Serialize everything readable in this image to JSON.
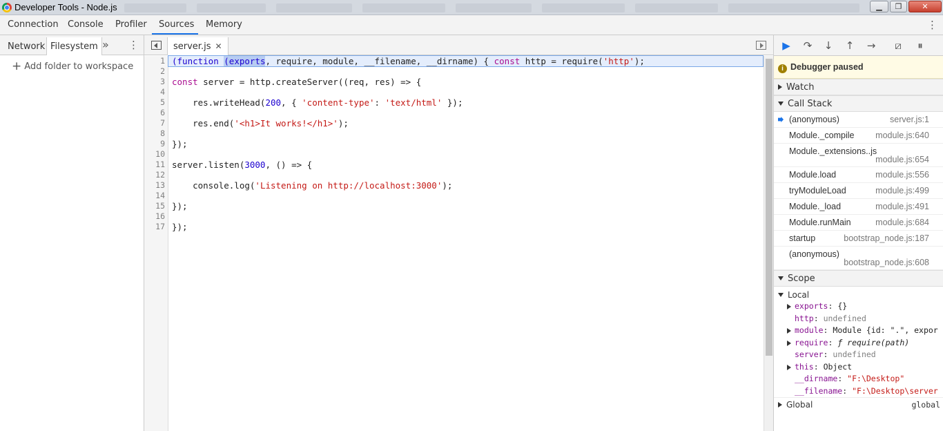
{
  "window": {
    "title": "Developer Tools - Node.js",
    "minimize": "▁",
    "maximize": "❐",
    "close": "✕"
  },
  "main_tabs": [
    "Connection",
    "Console",
    "Profiler",
    "Sources",
    "Memory"
  ],
  "navigator": {
    "tabs": [
      "Network",
      "Filesystem"
    ],
    "more": "»",
    "add_folder": "Add folder to workspace"
  },
  "editor": {
    "file_tab": "server.js",
    "line_numbers": [
      "1",
      "2",
      "3",
      "4",
      "5",
      "6",
      "7",
      "8",
      "9",
      "10",
      "11",
      "12",
      "13",
      "14",
      "15",
      "16",
      "17"
    ]
  },
  "debugger": {
    "paused_text": "Debugger paused",
    "watch": "Watch",
    "call_stack": "Call Stack",
    "frames": [
      {
        "fn": "(anonymous)",
        "loc": "server.js:1"
      },
      {
        "fn": "Module._compile",
        "loc": "module.js:640"
      },
      {
        "fn": "Module._extensions..js",
        "loc": "module.js:654"
      },
      {
        "fn": "Module.load",
        "loc": "module.js:556"
      },
      {
        "fn": "tryModuleLoad",
        "loc": "module.js:499"
      },
      {
        "fn": "Module._load",
        "loc": "module.js:491"
      },
      {
        "fn": "Module.runMain",
        "loc": "module.js:684"
      },
      {
        "fn": "startup",
        "loc": "bootstrap_node.js:187"
      },
      {
        "fn": "(anonymous)",
        "loc": "bootstrap_node.js:608"
      }
    ],
    "scope": "Scope",
    "local": "Local",
    "props": [
      {
        "name": "exports",
        "value": "{}"
      },
      {
        "name": "http",
        "value": "undefined"
      },
      {
        "name": "module",
        "value": "Module {id: \".\", expor"
      },
      {
        "name": "require",
        "value": "ƒ require(path)"
      },
      {
        "name": "server",
        "value": "undefined"
      },
      {
        "name": "this",
        "value": "Object"
      },
      {
        "name": "__dirname",
        "value": "\"F:\\Desktop\""
      },
      {
        "name": "__filename",
        "value": "\"F:\\Desktop\\server"
      }
    ],
    "global": "Global",
    "global_value": "global"
  }
}
